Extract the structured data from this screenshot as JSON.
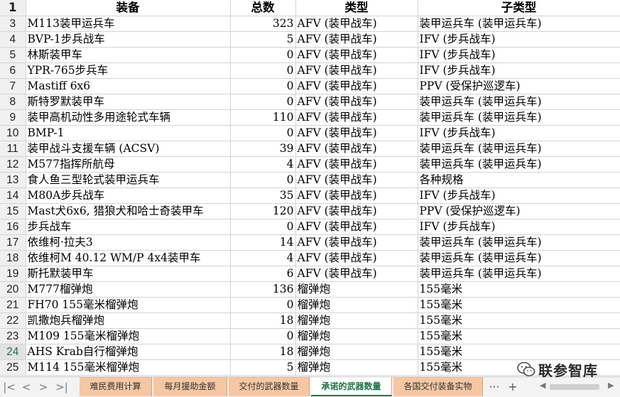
{
  "header": {
    "row_number": "1",
    "col_equipment": "装备",
    "col_total": "总数",
    "col_type": "类型",
    "col_subtype": "子类型"
  },
  "rows": [
    {
      "num": "3",
      "equipment": "M113装甲运兵车",
      "total": "323",
      "type": "AFV (装甲战车)",
      "subtype": "装甲运兵车 (装甲运兵车)"
    },
    {
      "num": "4",
      "equipment": "BVP-1步兵战车",
      "total": "5",
      "type": "AFV (装甲战车)",
      "subtype": "IFV (步兵战车)"
    },
    {
      "num": "5",
      "equipment": "林斯装甲车",
      "total": "0",
      "type": "AFV (装甲战车)",
      "subtype": "IFV (步兵战车)"
    },
    {
      "num": "6",
      "equipment": "YPR-765步兵车",
      "total": "0",
      "type": "AFV (装甲战车)",
      "subtype": "IFV (步兵战车)"
    },
    {
      "num": "7",
      "equipment": "Mastiff 6x6",
      "total": "0",
      "type": "AFV (装甲战车)",
      "subtype": "PPV (受保护巡逻车)"
    },
    {
      "num": "8",
      "equipment": "斯特罗默装甲车",
      "total": "0",
      "type": "AFV (装甲战车)",
      "subtype": "装甲运兵车 (装甲运兵车)"
    },
    {
      "num": "9",
      "equipment": "装甲高机动性多用途轮式车辆",
      "total": "110",
      "type": "AFV (装甲战车)",
      "subtype": "装甲运兵车 (装甲运兵车)"
    },
    {
      "num": "10",
      "equipment": "BMP-1",
      "total": "0",
      "type": "AFV (装甲战车)",
      "subtype": "IFV (步兵战车)"
    },
    {
      "num": "11",
      "equipment": "装甲战斗支援车辆 (ACSV)",
      "total": "39",
      "type": "AFV (装甲战车)",
      "subtype": "装甲运兵车 (装甲运兵车)"
    },
    {
      "num": "12",
      "equipment": "M577指挥所航母",
      "total": "4",
      "type": "AFV (装甲战车)",
      "subtype": "装甲运兵车 (装甲运兵车)"
    },
    {
      "num": "13",
      "equipment": "食人鱼三型轮式装甲运兵车",
      "total": "0",
      "type": "AFV (装甲战车)",
      "subtype": "各种规格"
    },
    {
      "num": "14",
      "equipment": "M80A步兵战车",
      "total": "35",
      "type": "AFV (装甲战车)",
      "subtype": "IFV (步兵战车)"
    },
    {
      "num": "15",
      "equipment": "Mast犬6x6, 猎狼犬和哈士奇装甲车",
      "total": "120",
      "type": "AFV (装甲战车)",
      "subtype": "PPV (受保护巡逻车)"
    },
    {
      "num": "16",
      "equipment": "步兵战车",
      "total": "0",
      "type": "AFV (装甲战车)",
      "subtype": "IFV (步兵战车)"
    },
    {
      "num": "17",
      "equipment": "依维柯·拉夫3",
      "total": "14",
      "type": "AFV (装甲战车)",
      "subtype": "装甲运兵车 (装甲运兵车)"
    },
    {
      "num": "18",
      "equipment": "依维柯M 40.12 WM/P 4x4装甲车",
      "total": "4",
      "type": "AFV (装甲战车)",
      "subtype": "装甲运兵车 (装甲运兵车)"
    },
    {
      "num": "19",
      "equipment": "斯托默装甲车",
      "total": "6",
      "type": "AFV (装甲战车)",
      "subtype": "装甲运兵车 (装甲运兵车)"
    },
    {
      "num": "20",
      "equipment": "M777榴弹炮",
      "total": "136",
      "type": "榴弹炮",
      "subtype": "155毫米"
    },
    {
      "num": "21",
      "equipment": "FH70 155毫米榴弹炮",
      "total": "0",
      "type": "榴弹炮",
      "subtype": "155毫米"
    },
    {
      "num": "22",
      "equipment": "凯撒炮兵榴弹炮",
      "total": "18",
      "type": "榴弹炮",
      "subtype": "155毫米"
    },
    {
      "num": "23",
      "equipment": "M109 155毫米榴弹炮",
      "total": "0",
      "type": "榴弹炮",
      "subtype": "155毫米"
    },
    {
      "num": "24",
      "equipment": "AHS Krab自行榴弹炮",
      "total": "18",
      "type": "榴弹炮",
      "subtype": "155毫米"
    },
    {
      "num": "25",
      "equipment": "M114 155毫米榴弹炮",
      "total": "5",
      "type": "榴弹炮",
      "subtype": "155毫米"
    }
  ],
  "active_row": "24",
  "tabs": {
    "tab1": "难民费用计算",
    "tab2": "每月援助金额",
    "tab3": "交付的武器数量",
    "tab4": "承诺的武器数量",
    "tab5": "各国交付装备实物",
    "active": "承诺的武器数量",
    "more": "···",
    "add": "+"
  },
  "watermark": {
    "text": "联参智库",
    "icon": "wechat-icon"
  },
  "colors": {
    "tab_bg": "#f5c7a3",
    "active_tab_text": "#217346",
    "grid_line": "#d4d4d4"
  }
}
